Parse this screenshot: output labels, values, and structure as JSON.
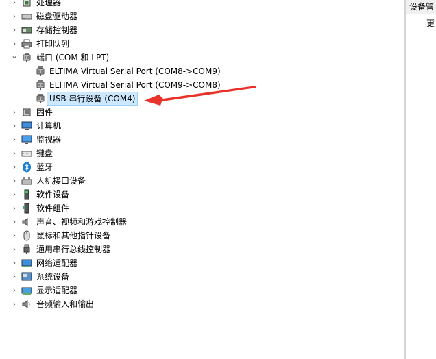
{
  "tree": [
    {
      "label": "处理器",
      "indent": 0,
      "expanded": false,
      "icon": "processor-icon"
    },
    {
      "label": "磁盘驱动器",
      "indent": 0,
      "expanded": false,
      "icon": "disk-drive-icon"
    },
    {
      "label": "存储控制器",
      "indent": 0,
      "expanded": false,
      "icon": "storage-controller-icon"
    },
    {
      "label": "打印队列",
      "indent": 0,
      "expanded": false,
      "icon": "printer-icon"
    },
    {
      "label": "端口 (COM 和 LPT)",
      "indent": 0,
      "expanded": true,
      "icon": "port-icon"
    },
    {
      "label": "ELTIMA Virtual Serial Port (COM8->COM9)",
      "indent": 1,
      "expanded": null,
      "icon": "port-icon"
    },
    {
      "label": "ELTIMA Virtual Serial Port (COM9->COM8)",
      "indent": 1,
      "expanded": null,
      "icon": "port-icon"
    },
    {
      "label": "USB 串行设备 (COM4)",
      "indent": 1,
      "expanded": null,
      "icon": "port-icon",
      "selected": true
    },
    {
      "label": "固件",
      "indent": 0,
      "expanded": false,
      "icon": "firmware-icon"
    },
    {
      "label": "计算机",
      "indent": 0,
      "expanded": false,
      "icon": "computer-icon"
    },
    {
      "label": "监视器",
      "indent": 0,
      "expanded": false,
      "icon": "monitor-icon"
    },
    {
      "label": "键盘",
      "indent": 0,
      "expanded": false,
      "icon": "keyboard-icon"
    },
    {
      "label": "蓝牙",
      "indent": 0,
      "expanded": false,
      "icon": "bluetooth-icon"
    },
    {
      "label": "人机接口设备",
      "indent": 0,
      "expanded": false,
      "icon": "hid-icon"
    },
    {
      "label": "软件设备",
      "indent": 0,
      "expanded": false,
      "icon": "software-device-icon"
    },
    {
      "label": "软件组件",
      "indent": 0,
      "expanded": false,
      "icon": "software-component-icon"
    },
    {
      "label": "声音、视频和游戏控制器",
      "indent": 0,
      "expanded": false,
      "icon": "speaker-icon"
    },
    {
      "label": "鼠标和其他指针设备",
      "indent": 0,
      "expanded": false,
      "icon": "mouse-icon"
    },
    {
      "label": "通用串行总线控制器",
      "indent": 0,
      "expanded": false,
      "icon": "usb-icon"
    },
    {
      "label": "网络适配器",
      "indent": 0,
      "expanded": false,
      "icon": "network-adapter-icon"
    },
    {
      "label": "系统设备",
      "indent": 0,
      "expanded": false,
      "icon": "system-device-icon"
    },
    {
      "label": "显示适配器",
      "indent": 0,
      "expanded": false,
      "icon": "display-adapter-icon"
    },
    {
      "label": "音频输入和输出",
      "indent": 0,
      "expanded": false,
      "icon": "audio-io-icon"
    }
  ],
  "right_panel": {
    "title": "设备管",
    "more": "更"
  },
  "colors": {
    "selection_bg": "#cce8ff",
    "selection_border": "#99d1ff",
    "arrow": "#e8322a",
    "icon_blue": "#1e7fd6"
  }
}
